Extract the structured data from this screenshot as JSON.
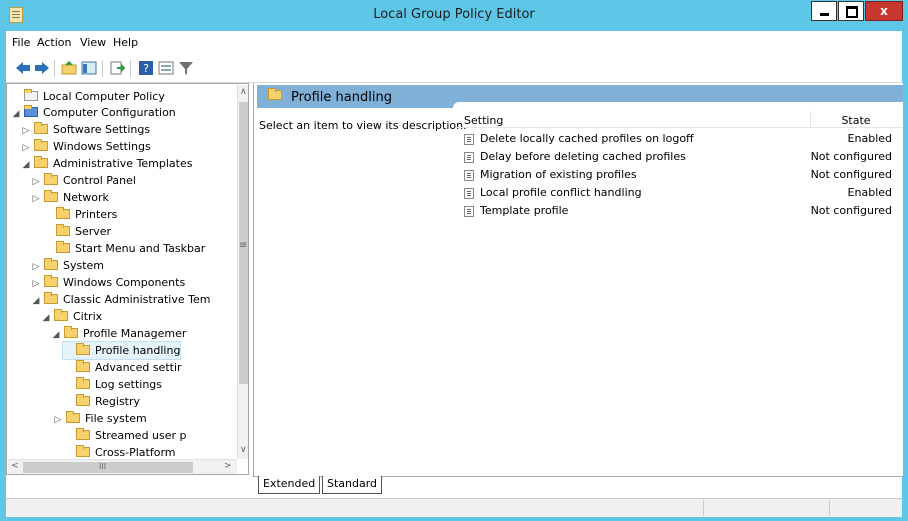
{
  "window": {
    "title": "Local Group Policy Editor",
    "close_glyph": "x"
  },
  "menu": [
    "File",
    "Action",
    "View",
    "Help"
  ],
  "toolbar": {
    "icons": [
      "back-arrow-icon",
      "forward-arrow-icon",
      "up-folder-icon",
      "show-hide-tree-icon",
      "export-list-icon",
      "help-icon",
      "properties-icon",
      "filter-icon"
    ]
  },
  "tree": {
    "items": [
      {
        "label": "Local Computer Policy",
        "icon": "policy-icon",
        "expander": ""
      },
      {
        "label": "Computer Configuration",
        "icon": "computer-icon",
        "expander": "◢"
      },
      {
        "label": "Software Settings",
        "icon": "folder-icon",
        "expander": "▷"
      },
      {
        "label": "Windows Settings",
        "icon": "folder-icon",
        "expander": "▷"
      },
      {
        "label": "Administrative Templates",
        "icon": "folder-icon",
        "expander": "◢"
      },
      {
        "label": "Control Panel",
        "icon": "folder-icon",
        "expander": "▷"
      },
      {
        "label": "Network",
        "icon": "folder-icon",
        "expander": "▷"
      },
      {
        "label": "Printers",
        "icon": "folder-icon",
        "expander": ""
      },
      {
        "label": "Server",
        "icon": "folder-icon",
        "expander": ""
      },
      {
        "label": "Start Menu and Taskbar",
        "icon": "folder-icon",
        "expander": ""
      },
      {
        "label": "System",
        "icon": "folder-icon",
        "expander": "▷"
      },
      {
        "label": "Windows Components",
        "icon": "folder-icon",
        "expander": "▷"
      },
      {
        "label": "Classic Administrative Tem",
        "icon": "folder-icon",
        "expander": "◢"
      },
      {
        "label": "Citrix",
        "icon": "folder-icon",
        "expander": "◢"
      },
      {
        "label": "Profile Managemer",
        "icon": "folder-icon",
        "expander": "◢"
      },
      {
        "label": "Profile handling",
        "icon": "folder-icon",
        "expander": "",
        "selected": true
      },
      {
        "label": "Advanced settir",
        "icon": "folder-icon",
        "expander": ""
      },
      {
        "label": "Log settings",
        "icon": "folder-icon",
        "expander": ""
      },
      {
        "label": "Registry",
        "icon": "folder-icon",
        "expander": ""
      },
      {
        "label": "File system",
        "icon": "folder-icon",
        "expander": "▷"
      },
      {
        "label": "Streamed user p",
        "icon": "folder-icon",
        "expander": ""
      },
      {
        "label": "Cross-Platform",
        "icon": "folder-icon",
        "expander": ""
      }
    ],
    "hscroll_glyph": "III",
    "vscroll_glyph": "≡"
  },
  "panel": {
    "title": "Profile handling",
    "description": "Select an item to view its description.",
    "columns": {
      "setting": "Setting",
      "state": "State"
    },
    "rows": [
      {
        "setting": "Delete locally cached profiles on logoff",
        "state": "Enabled"
      },
      {
        "setting": "Delay before deleting cached profiles",
        "state": "Not configured"
      },
      {
        "setting": "Migration of existing profiles",
        "state": "Not configured"
      },
      {
        "setting": "Local profile conflict handling",
        "state": "Enabled"
      },
      {
        "setting": "Template profile",
        "state": "Not configured"
      }
    ]
  },
  "tabs": [
    "Extended",
    "Standard"
  ],
  "colors": {
    "accent": "#5ec7e8",
    "band": "#7fb0d8",
    "selection": "#e5f3fb",
    "close": "#c7372f"
  }
}
